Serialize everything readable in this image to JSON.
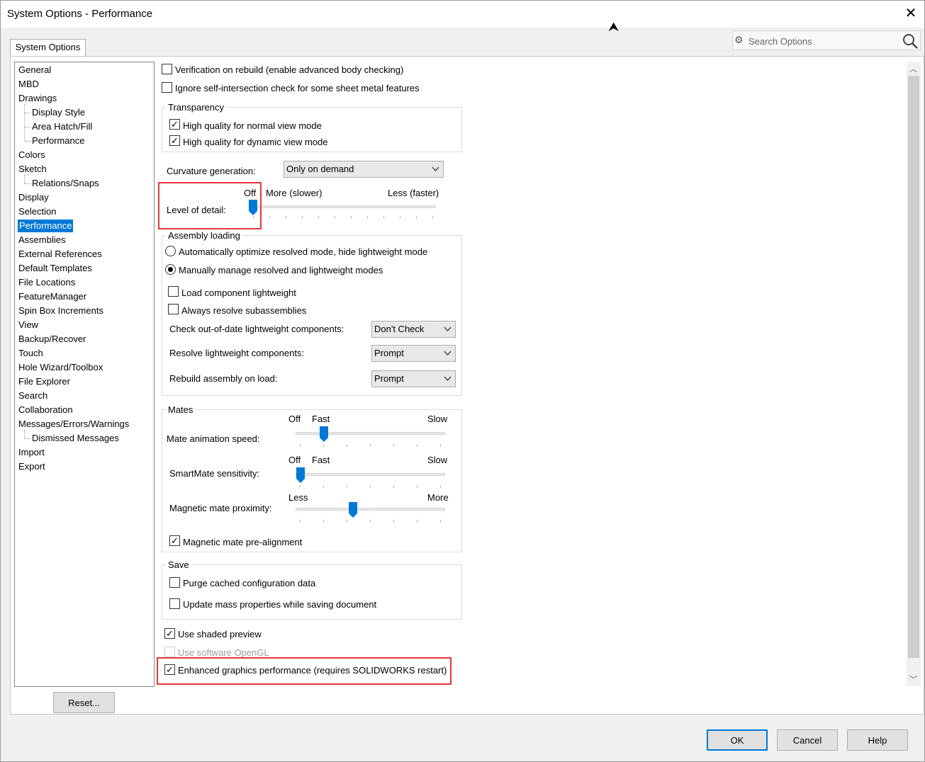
{
  "window": {
    "title": "System Options - Performance"
  },
  "tab": {
    "label": "System Options"
  },
  "search": {
    "placeholder": "Search Options"
  },
  "tree": [
    {
      "label": "General",
      "level": 0
    },
    {
      "label": "MBD",
      "level": 0
    },
    {
      "label": "Drawings",
      "level": 0
    },
    {
      "label": "Display Style",
      "level": 1
    },
    {
      "label": "Area Hatch/Fill",
      "level": 1
    },
    {
      "label": "Performance",
      "level": 1
    },
    {
      "label": "Colors",
      "level": 0
    },
    {
      "label": "Sketch",
      "level": 0
    },
    {
      "label": "Relations/Snaps",
      "level": 1
    },
    {
      "label": "Display",
      "level": 0
    },
    {
      "label": "Selection",
      "level": 0
    },
    {
      "label": "Performance",
      "level": 0,
      "selected": true
    },
    {
      "label": "Assemblies",
      "level": 0
    },
    {
      "label": "External References",
      "level": 0
    },
    {
      "label": "Default Templates",
      "level": 0
    },
    {
      "label": "File Locations",
      "level": 0
    },
    {
      "label": "FeatureManager",
      "level": 0
    },
    {
      "label": "Spin Box Increments",
      "level": 0
    },
    {
      "label": "View",
      "level": 0
    },
    {
      "label": "Backup/Recover",
      "level": 0
    },
    {
      "label": "Touch",
      "level": 0
    },
    {
      "label": "Hole Wizard/Toolbox",
      "level": 0
    },
    {
      "label": "File Explorer",
      "level": 0
    },
    {
      "label": "Search",
      "level": 0
    },
    {
      "label": "Collaboration",
      "level": 0
    },
    {
      "label": "Messages/Errors/Warnings",
      "level": 0
    },
    {
      "label": "Dismissed Messages",
      "level": 1
    },
    {
      "label": "Import",
      "level": 0
    },
    {
      "label": "Export",
      "level": 0
    }
  ],
  "options": {
    "verification": "Verification on rebuild (enable advanced body checking)",
    "ignore_self": "Ignore self-intersection check for some sheet metal features",
    "transparency": {
      "title": "Transparency",
      "normal": "High quality for normal view mode",
      "dynamic": "High quality for dynamic view mode"
    },
    "curvature": {
      "label": "Curvature generation:",
      "value": "Only on demand"
    },
    "lod": {
      "label": "Level of detail:",
      "off": "Off",
      "more": "More (slower)",
      "less": "Less (faster)",
      "position": 0
    },
    "assembly": {
      "title": "Assembly loading",
      "auto": "Automatically optimize resolved mode, hide lightweight mode",
      "manual": "Manually manage resolved and lightweight modes",
      "load_light": "Load component lightweight",
      "always_resolve": "Always resolve subassemblies",
      "check_label": "Check out-of-date lightweight components:",
      "check_value": "Don't Check",
      "resolve_label": "Resolve lightweight components:",
      "resolve_value": "Prompt",
      "rebuild_label": "Rebuild assembly on load:",
      "rebuild_value": "Prompt"
    },
    "mates": {
      "title": "Mates",
      "anim_label": "Mate animation speed:",
      "anim_off": "Off",
      "anim_fast": "Fast",
      "anim_slow": "Slow",
      "smart_label": "SmartMate sensitivity:",
      "smart_off": "Off",
      "smart_fast": "Fast",
      "smart_slow": "Slow",
      "prox_label": "Magnetic mate proximity:",
      "prox_less": "Less",
      "prox_more": "More",
      "prealign": "Magnetic mate pre-alignment"
    },
    "save": {
      "title": "Save",
      "purge": "Purge cached configuration data",
      "mass": "Update mass properties while saving document"
    },
    "shaded": "Use shaded preview",
    "opengl": "Use software OpenGL",
    "enhanced": "Enhanced graphics performance (requires SOLIDWORKS restart)"
  },
  "buttons": {
    "reset": "Reset...",
    "ok": "OK",
    "cancel": "Cancel",
    "help": "Help"
  },
  "colors": {
    "accent": "#0078d7",
    "highlight": "#e8373b"
  }
}
